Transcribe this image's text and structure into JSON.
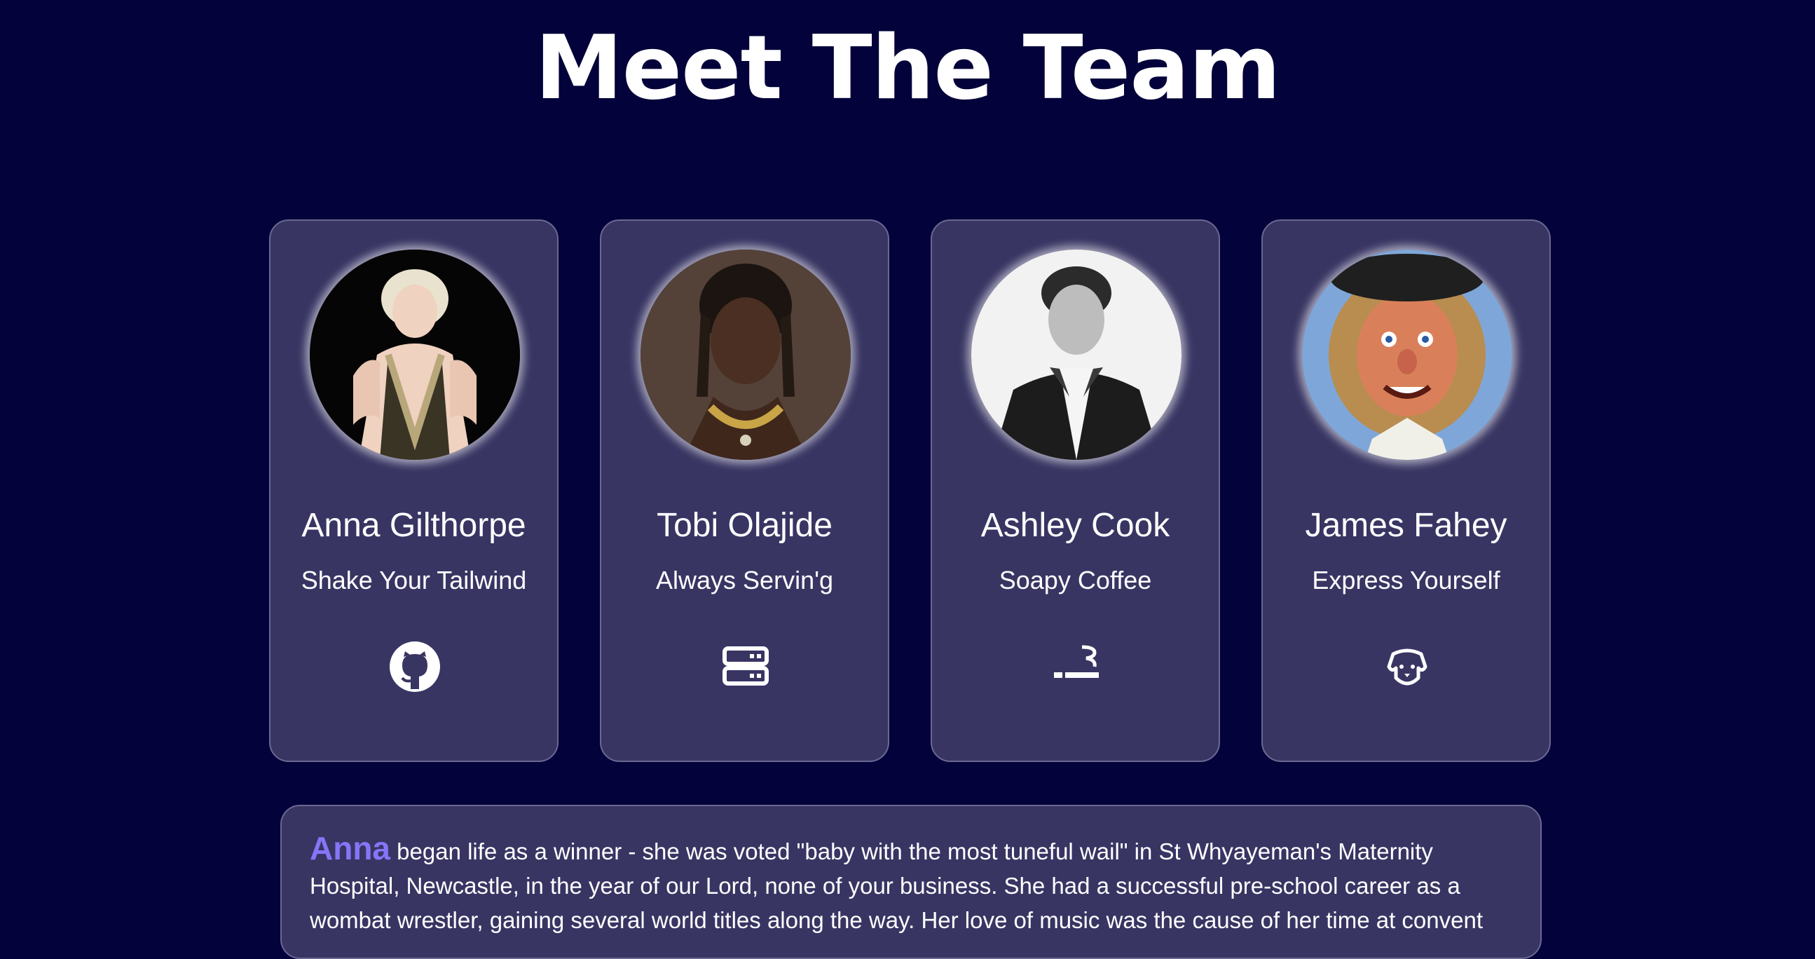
{
  "page": {
    "title": "Meet The Team"
  },
  "colors": {
    "background": "#03023a",
    "card": "#383563",
    "card_border": "#6a6892",
    "accent": "#8675f7",
    "text": "#ffffff"
  },
  "team": [
    {
      "name": "Anna Gilthorpe",
      "tagline": "Shake Your Tailwind",
      "icon": "github-icon"
    },
    {
      "name": "Tobi Olajide",
      "tagline": "Always Servin'g",
      "icon": "server-icon"
    },
    {
      "name": "Ashley Cook",
      "tagline": "Soapy Coffee",
      "icon": "smoking-icon"
    },
    {
      "name": "James Fahey",
      "tagline": "Express Yourself",
      "icon": "dog-icon"
    }
  ],
  "bio": {
    "name": "Anna",
    "text": " began life as a winner - she was voted \"baby with the most tuneful wail\" in St Whyayeman's Maternity Hospital, Newcastle, in the year of our Lord, none of your business. She had a successful pre-school career as a wombat wrestler, gaining several world titles along the way. Her love of music was the cause of her time at convent"
  }
}
